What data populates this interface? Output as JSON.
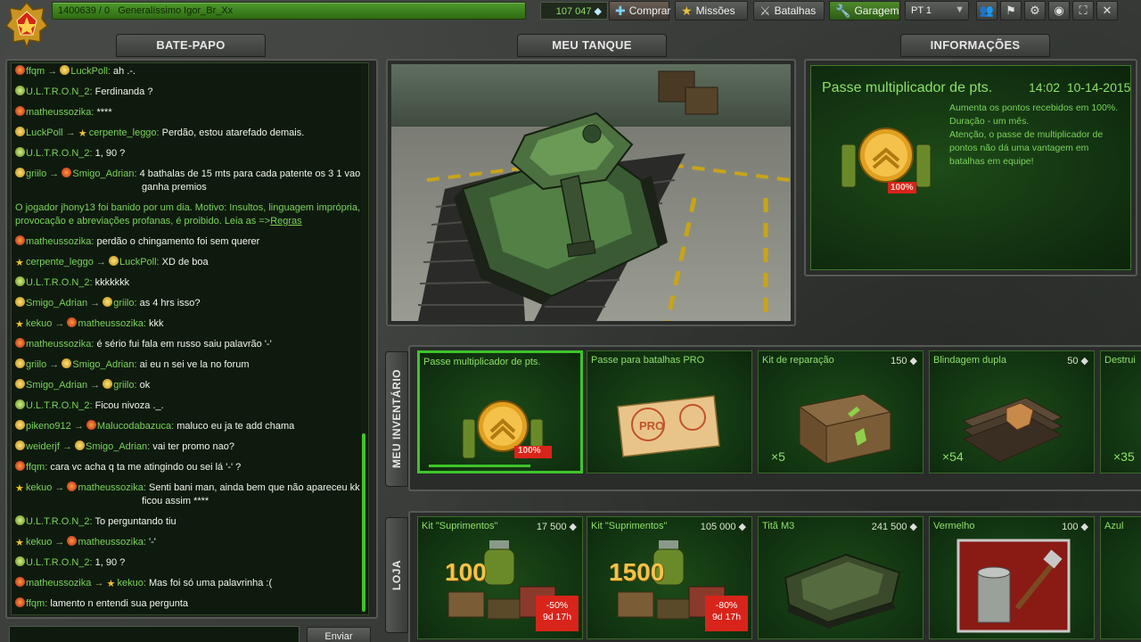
{
  "topbar": {
    "player_score": "1400639 / 0",
    "player_name": "Generalíssimo Igor_Br_Xx",
    "crystals": "107 047",
    "buy_label": "Comprar",
    "missions_label": "Missões",
    "battles_label": "Batalhas",
    "garage_label": "Garagem",
    "language": "PT 1"
  },
  "tabs": {
    "chat": "BATE-PAPO",
    "tank": "MEU TANQUE",
    "info": "INFORMAÇÕES"
  },
  "chat": {
    "messages": [
      {
        "from": "ffqm",
        "to": "LuckPoll:",
        "text": "ah .-."
      },
      {
        "from": "U.L.T.R.O.N_2:",
        "text": "Ferdinanda ?"
      },
      {
        "from": "matheussozika:",
        "text": "****"
      },
      {
        "from": "LuckPoll",
        "to": "cerpente_leggo:",
        "text": "Perdão, estou atarefado demais."
      },
      {
        "from": "U.L.T.R.O.N_2:",
        "text": "1, 90 ?"
      },
      {
        "from": "griilo",
        "to": "Smigo_Adrian:",
        "text": "4 bathalas de 15 mts para cada patente os 3 1 vao",
        "text2": "ganha premios"
      },
      {
        "system": "O jogador jhony13 foi banido por um dia. Motivo: Insultos, linguagem imprópria,",
        "system2": "provocação e abreviações profanas, é proibido. Leia as =>",
        "link": "Regras"
      },
      {
        "from": "matheussozika:",
        "text": "perdão o chingamento foi sem querer"
      },
      {
        "from": "cerpente_leggo",
        "to": "LuckPoll:",
        "text": "XD de boa"
      },
      {
        "from": "U.L.T.R.O.N_2:",
        "text": "kkkkkkk"
      },
      {
        "from": "Smigo_Adrian",
        "to": "griilo:",
        "text": "as 4 hrs isso?"
      },
      {
        "from": "kekuo",
        "to": "matheussozika:",
        "text": "kkk"
      },
      {
        "from": "matheussozika:",
        "text": "é sério fui fala em russo saiu palavrão '-'"
      },
      {
        "from": "griilo",
        "to": "Smigo_Adrian:",
        "text": "ai eu n sei ve la no forum"
      },
      {
        "from": "Smigo_Adrian",
        "to": "griilo:",
        "text": "ok"
      },
      {
        "from": "U.L.T.R.O.N_2:",
        "text": "Ficou nivoza ._."
      },
      {
        "from": "pikeno912",
        "to": "Malucodabazuca:",
        "text": "maluco eu ja te add chama"
      },
      {
        "from": "weiderjf",
        "to": "Smigo_Adrian:",
        "text": "vai ter promo nao?"
      },
      {
        "from": "ffqm:",
        "text": "cara vc acha q ta me atingindo ou sei lá '-' ?"
      },
      {
        "from": "kekuo",
        "to": "matheussozika:",
        "text": "Senti bani man, ainda bem que não apareceu kk",
        "text2": "ficou assim ****"
      },
      {
        "from": "U.L.T.R.O.N_2:",
        "text": "To perguntando tiu"
      },
      {
        "from": "kekuo",
        "to": "matheussozika:",
        "text": "'-'"
      },
      {
        "from": "U.L.T.R.O.N_2:",
        "text": "1, 90 ?"
      },
      {
        "from": "matheussozika",
        "to": "kekuo:",
        "text": "Mas foi só uma palavrinha :("
      },
      {
        "from": "ffqm:",
        "text": "lamento n entendi sua pergunta"
      }
    ],
    "send_label": "Enviar"
  },
  "info": {
    "title": "Passe multiplicador de pts.",
    "time": "14:02",
    "date": "10-14-2015",
    "description": "Aumenta os pontos recebidos em 100%.\nDuração - um mês.\nAtenção, o passe de multiplicador de pontos não dá uma vantagem em batalhas em equipe!",
    "badge": "100%"
  },
  "inventory": {
    "label": "MEU INVENTÁRIO",
    "items": [
      {
        "name": "Passe multiplicador de pts.",
        "price": "",
        "count": "",
        "badge": "100%"
      },
      {
        "name": "Passe para batalhas PRO",
        "price": "",
        "count": ""
      },
      {
        "name": "Kit de reparação",
        "price": "150",
        "count": "×5"
      },
      {
        "name": "Blindagem dupla",
        "price": "50",
        "count": "×54"
      },
      {
        "name": "Destrui",
        "price": "",
        "count": "×35"
      }
    ]
  },
  "shop": {
    "label": "LOJA",
    "items": [
      {
        "name": "Kit \"Suprimentos\"",
        "price": "17 500",
        "amount": "100",
        "discount": "-50%",
        "timer": "9d 17h"
      },
      {
        "name": "Kit \"Suprimentos\"",
        "price": "105 000",
        "amount": "1500",
        "discount": "-80%",
        "timer": "9d 17h"
      },
      {
        "name": "Titã M3",
        "price": "241 500"
      },
      {
        "name": "Vermelho",
        "price": "100"
      },
      {
        "name": "Azul",
        "price": ""
      }
    ]
  },
  "colors": {
    "accent_green": "#3ec42b",
    "text_green": "#79d35a",
    "discount_red": "#d8241a"
  },
  "icons": [
    "rank-emblem-icon",
    "crystal-icon",
    "plus-icon",
    "star-icon",
    "swords-icon",
    "wrench-icon",
    "chevron-down-icon",
    "friends-icon",
    "clan-icon",
    "settings-icon",
    "sound-icon",
    "fullscreen-icon",
    "close-icon"
  ]
}
